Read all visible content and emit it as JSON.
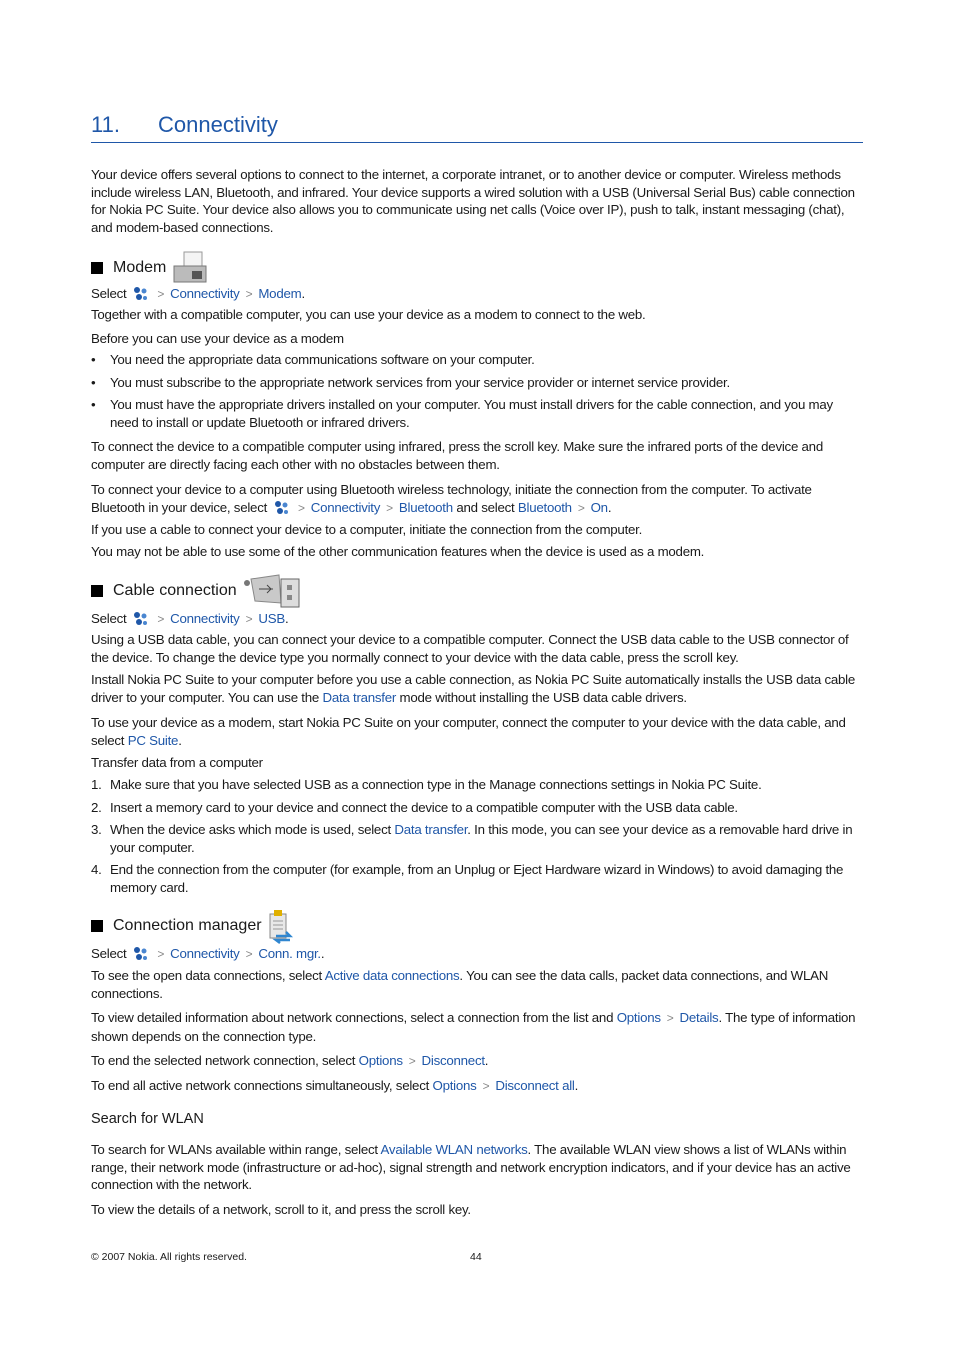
{
  "chapter": {
    "number": "11.",
    "title": "Connectivity"
  },
  "intro": "Your device offers several options to connect to the internet, a corporate intranet, or to another device or computer. Wireless methods include wireless LAN, Bluetooth, and infrared. Your device supports a wired solution with a USB (Universal Serial Bus) cable connection for Nokia PC Suite. Your device also allows you to communicate using net calls (Voice over IP), push to talk, instant messaging (chat), and modem-based connections.",
  "common": {
    "select": "Select",
    "menu_icon": "menu-icon",
    "separator": ">"
  },
  "modem": {
    "heading": "Modem",
    "icon": "fax-modem-icon",
    "path": [
      "Connectivity",
      "Modem"
    ],
    "desc": "Together with a compatible computer, you can use your device as a modem to connect to the web.",
    "subheading": "Before you can use your device as a modem",
    "bullets": [
      "You need the appropriate data communications software on your computer.",
      "You must subscribe to the appropriate network services from your service provider or internet service provider.",
      "You must have the appropriate drivers installed on your computer. You must install drivers for the cable connection, and you may need to install or update Bluetooth or infrared drivers."
    ],
    "infrared": "To connect the device to a compatible computer using infrared, press the scroll key. Make sure the infrared ports of the device and computer are directly facing each other with no obstacles between them.",
    "bt_text1": "To connect your device to a computer using Bluetooth wireless technology, initiate the connection from the computer. To activate Bluetooth in your device, select",
    "bt_path1": [
      "Connectivity",
      "Bluetooth"
    ],
    "bt_text2": "and select",
    "bt_path2": [
      "Bluetooth",
      "On"
    ],
    "cable": "If you use a cable to connect your device to a computer, initiate the connection from the computer.",
    "note": "You may not be able to use some of the other communication features when the device is used as a modem."
  },
  "cable": {
    "heading": "Cable connection",
    "icon": "usb-icon",
    "path": [
      "Connectivity",
      "USB"
    ],
    "p1": "Using a USB data cable, you can connect your device to a compatible computer. Connect the USB data cable to the USB connector of the device. To change the device type you normally connect to your device with the data cable, press the scroll key.",
    "p2a": "Install Nokia PC Suite to your computer before you use a cable connection, as Nokia PC Suite automatically installs the USB data cable driver to your computer. You can use the",
    "p2link": "Data transfer",
    "p2b": "mode without installing the USB data cable drivers.",
    "p3a": "To use your device as a modem, start Nokia PC Suite on your computer, connect the computer to your device with the data cable, and select",
    "p3link": "PC Suite",
    "subheading": "Transfer data from a computer",
    "steps": [
      {
        "n": "1.",
        "text": "Make sure that you have selected USB as a connection type in the Manage connections settings in Nokia PC Suite."
      },
      {
        "n": "2.",
        "text": "Insert a memory card to your device and connect the device to a compatible computer with the USB data cable."
      },
      {
        "n": "3.",
        "a": "When the device asks which mode is used, select",
        "link": "Data transfer",
        "b": ". In this mode, you can see your device as a removable hard drive in your computer."
      },
      {
        "n": "4.",
        "text": "End the connection from the computer (for example, from an Unplug or Eject Hardware wizard in Windows) to avoid damaging the memory card."
      }
    ]
  },
  "connmgr": {
    "heading": "Connection manager",
    "icon": "connection-manager-icon",
    "path": [
      "Connectivity",
      "Conn. mgr."
    ],
    "p1a": "To see the open data connections, select",
    "p1link": "Active data connections",
    "p1b": ". You can see the data calls, packet data connections, and WLAN connections.",
    "p2a": "To view detailed information about network connections, select a connection from the list and",
    "p2path": [
      "Options",
      "Details"
    ],
    "p2b": ". The type of information shown depends on the connection type.",
    "p3a": "To end the selected network connection, select",
    "p3path": [
      "Options",
      "Disconnect"
    ],
    "p4a": "To end all active network connections simultaneously, select",
    "p4path": [
      "Options",
      "Disconnect all"
    ],
    "wlan_heading": "Search for WLAN",
    "w1a": "To search for WLANs available within range, select",
    "w1link": "Available WLAN networks",
    "w1b": ". The available WLAN view shows a list of WLANs within range, their network mode (infrastructure or ad-hoc), signal strength and network encryption indicators, and if your device has an active connection with the network.",
    "w2": "To view the details of a network, scroll to it, and press the scroll key."
  },
  "footer": {
    "copyright": "© 2007 Nokia. All rights reserved.",
    "page": "44"
  }
}
